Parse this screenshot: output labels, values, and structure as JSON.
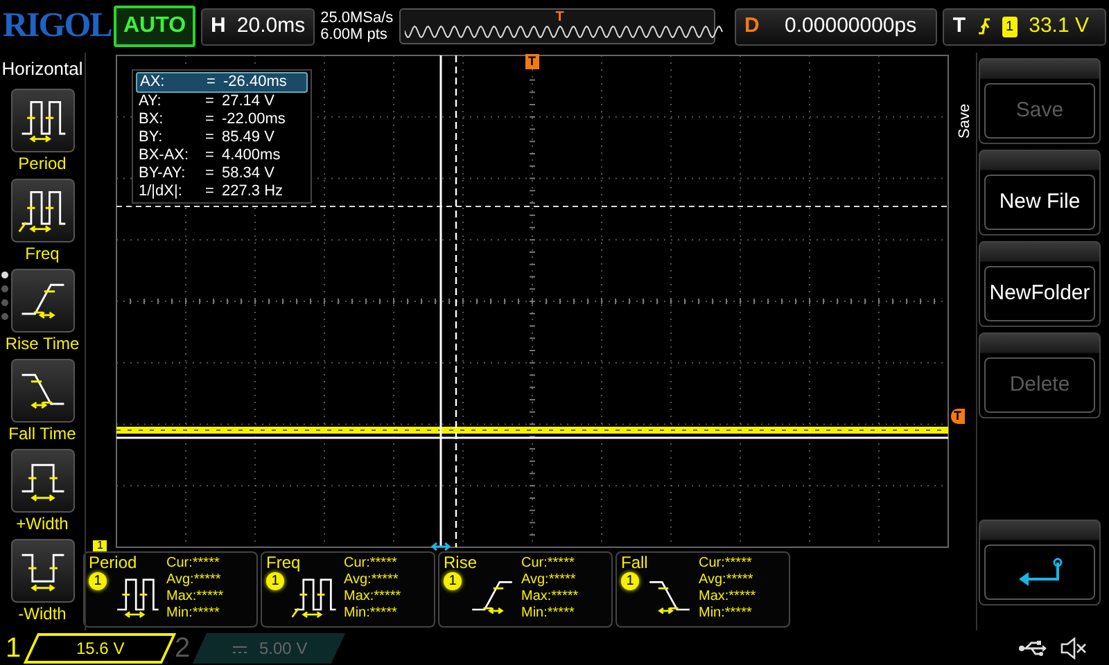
{
  "header": {
    "logo": "RIGOL",
    "run_state": "AUTO",
    "timebase": {
      "label": "H",
      "value": "20.0ms"
    },
    "sample_rate": "25.0MSa/s",
    "memory_depth": "6.00M pts",
    "overview_marker": "T",
    "delay": {
      "label": "D",
      "value": "0.00000000ps"
    },
    "trigger": {
      "label": "T",
      "source": "1",
      "level": "33.1 V"
    }
  },
  "left_menu": {
    "title": "Horizontal",
    "page_dots": [
      {
        "selected": true
      },
      {
        "selected": false
      },
      {
        "selected": false
      },
      {
        "selected": false
      }
    ],
    "items": [
      {
        "label": "Period",
        "kind": "period"
      },
      {
        "label": "Freq",
        "kind": "freq"
      },
      {
        "label": "Rise Time",
        "kind": "rise"
      },
      {
        "label": "Fall Time",
        "kind": "fall"
      },
      {
        "label": "+Width",
        "kind": "pwidth"
      },
      {
        "label": "-Width",
        "kind": "nwidth"
      }
    ]
  },
  "graticule": {
    "trigger_position_marker": "T",
    "trigger_level_marker": "T",
    "channel_marker": "1"
  },
  "cursor_readout": [
    {
      "label": "AX:",
      "equals": "=",
      "value": "-26.40ms",
      "selected": true
    },
    {
      "label": "AY:",
      "equals": "=",
      "value": "27.14 V",
      "selected": false
    },
    {
      "label": "BX:",
      "equals": "=",
      "value": "-22.00ms",
      "selected": false
    },
    {
      "label": "BY:",
      "equals": "=",
      "value": "85.49 V",
      "selected": false
    },
    {
      "label": "BX-AX:",
      "equals": "=",
      "value": "4.400ms",
      "selected": false
    },
    {
      "label": "BY-AY:",
      "equals": "=",
      "value": "58.34 V",
      "selected": false
    },
    {
      "label": "1/|dX|:",
      "equals": "=",
      "value": "227.3 Hz",
      "selected": false
    }
  ],
  "measurements": [
    {
      "name": "Period",
      "kind": "period",
      "source": "1",
      "stats": [
        "Cur:*****",
        "Avg:*****",
        "Max:*****",
        "Min:*****"
      ]
    },
    {
      "name": "Freq",
      "kind": "freq",
      "source": "1",
      "stats": [
        "Cur:*****",
        "Avg:*****",
        "Max:*****",
        "Min:*****"
      ]
    },
    {
      "name": "Rise",
      "kind": "rise",
      "source": "1",
      "stats": [
        "Cur:*****",
        "Avg:*****",
        "Max:*****",
        "Min:*****"
      ]
    },
    {
      "name": "Fall",
      "kind": "fall",
      "source": "1",
      "stats": [
        "Cur:*****",
        "Avg:*****",
        "Max:*****",
        "Min:*****"
      ]
    }
  ],
  "right_menu": {
    "title": "Save",
    "buttons": [
      {
        "kind": "text",
        "label": "Save",
        "disabled": true
      },
      {
        "kind": "text",
        "label": "New File",
        "disabled": false
      },
      {
        "kind": "text",
        "label": "NewFolder",
        "disabled": false
      },
      {
        "kind": "text",
        "label": "Delete",
        "disabled": true
      },
      {
        "kind": "back",
        "disabled": false
      }
    ]
  },
  "status_bar": {
    "channels": [
      {
        "number": "1",
        "scale": "15.6 V",
        "active": true
      },
      {
        "number": "2",
        "scale": "5.00 V",
        "active": false
      }
    ]
  }
}
